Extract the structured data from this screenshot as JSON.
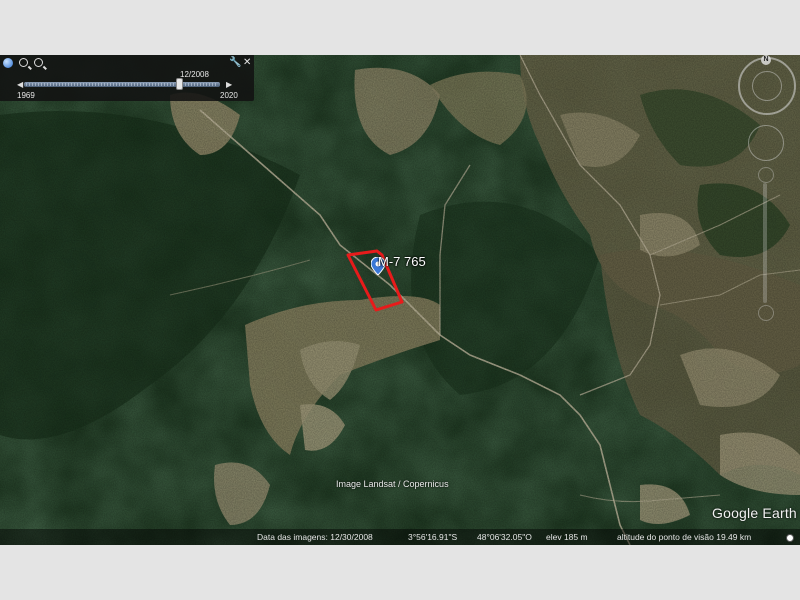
{
  "time_slider": {
    "current_date": "12/2008",
    "start_year": "1969",
    "end_year": "2020",
    "position": 0.79
  },
  "placemark": {
    "label": "M-7 765",
    "boundary_color": "#e81b1b",
    "pin_color": "#3a78d6"
  },
  "imagery_credit": "Image Landsat / Copernicus",
  "logo": "Google Earth",
  "status_bar": {
    "imagery_date": "Data das imagens: 12/30/2008",
    "latitude": "3°56'16.91\"S",
    "longitude": "48°06'32.05\"O",
    "elevation": "elev   185 m",
    "eye_altitude": "altitude do ponto de visão   19.49 km"
  },
  "colors": {
    "forest": "#1f3a22",
    "cleared_land": "#8c8566",
    "road": "#c8bfa5",
    "ui_panel": "#121212"
  },
  "icons": [
    "earth-icon",
    "zoom-out-icon",
    "zoom-in-icon",
    "wrench-icon",
    "close-icon",
    "compass-icon",
    "look-joystick-icon",
    "zoom-slider",
    "placemark-pin-icon"
  ]
}
